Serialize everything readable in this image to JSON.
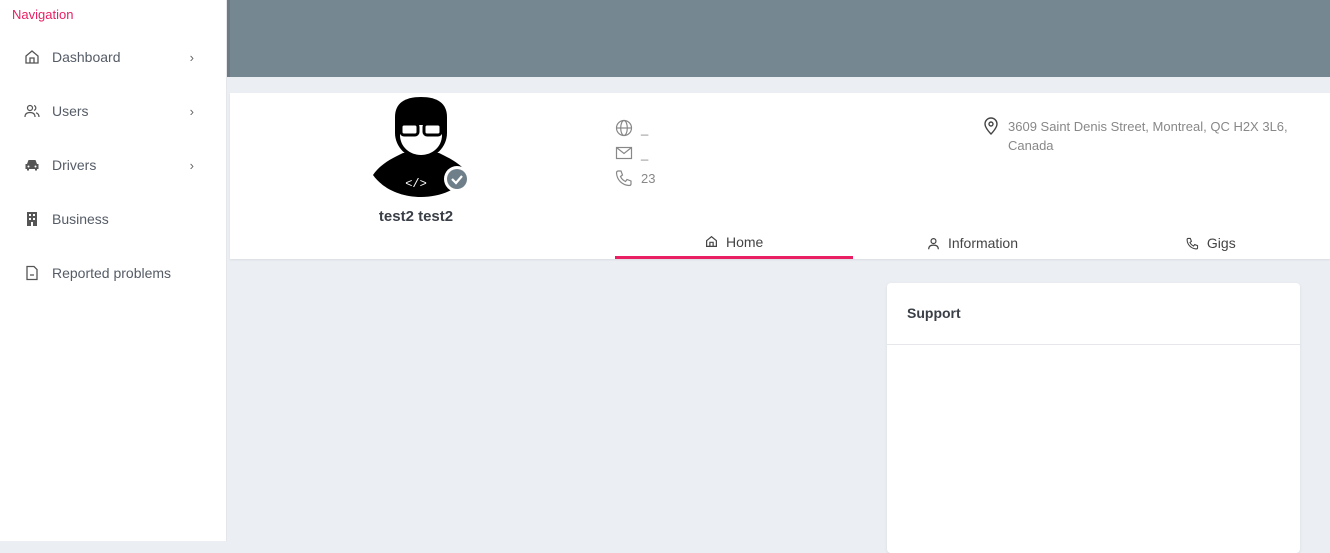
{
  "sidebar": {
    "title": "Navigation",
    "items": [
      {
        "label": "Dashboard",
        "icon": "home-icon",
        "chevron": "›"
      },
      {
        "label": "Users",
        "icon": "users-icon",
        "chevron": "›"
      },
      {
        "label": "Drivers",
        "icon": "car-icon",
        "chevron": "›"
      },
      {
        "label": "Business",
        "icon": "building-icon"
      },
      {
        "label": "Reported problems",
        "icon": "file-icon"
      }
    ]
  },
  "profile": {
    "name": "test2 test2",
    "website": "_",
    "email": "_",
    "phone": "23",
    "address": "3609 Saint Denis Street, Montreal, QC H2X 3L6, Canada",
    "avatar_code": "</>"
  },
  "tabs": [
    {
      "label": "Home",
      "active": true
    },
    {
      "label": "Information"
    },
    {
      "label": "Gigs"
    }
  ],
  "support": {
    "title": "Support"
  },
  "colors": {
    "accent": "#e91e63",
    "topbar": "#758892"
  }
}
